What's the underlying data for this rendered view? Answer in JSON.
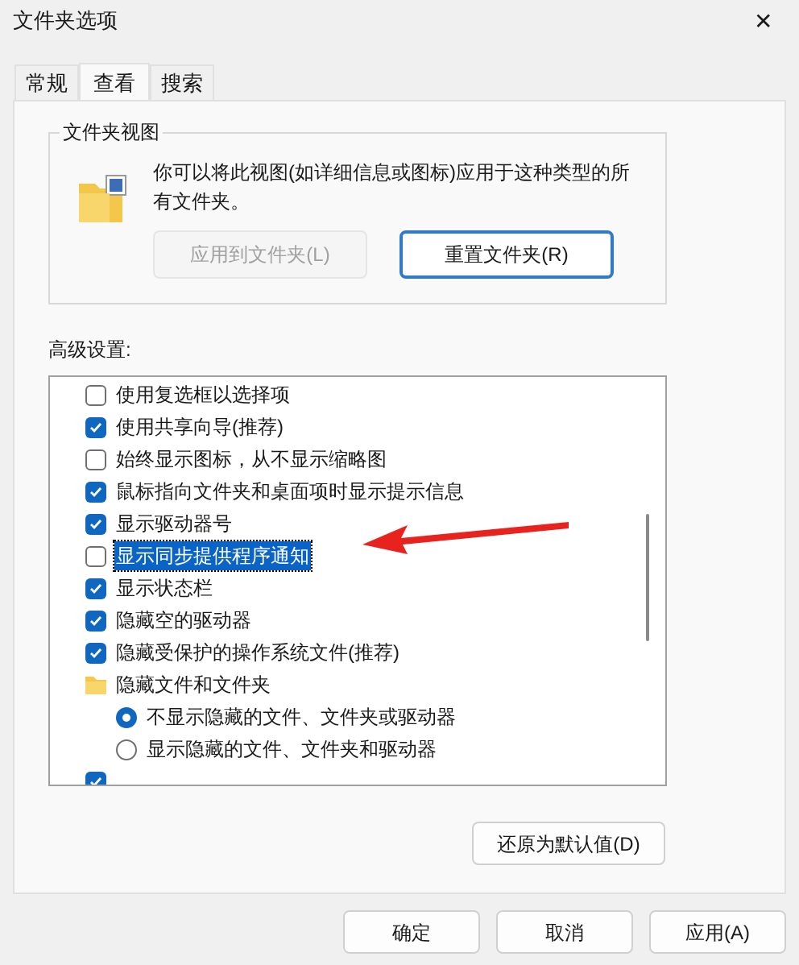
{
  "window": {
    "title": "文件夹选项",
    "close": "✕"
  },
  "tabs": [
    {
      "label": "常规",
      "selected": false
    },
    {
      "label": "查看",
      "selected": true
    },
    {
      "label": "搜索",
      "selected": false
    }
  ],
  "folder_views": {
    "title": "文件夹视图",
    "description": "你可以将此视图(如详细信息或图标)应用于这种类型的所有文件夹。",
    "buttons": [
      {
        "label": "应用到文件夹(L)",
        "disabled": true
      },
      {
        "label": "重置文件夹(R)",
        "disabled": false
      }
    ]
  },
  "advanced": {
    "label": "高级设置:",
    "items": [
      {
        "kind": "checkbox",
        "label": "使用复选框以选择项",
        "checked": false,
        "selected": false
      },
      {
        "kind": "checkbox",
        "label": "使用共享向导(推荐)",
        "checked": true,
        "selected": false
      },
      {
        "kind": "checkbox",
        "label": "始终显示图标，从不显示缩略图",
        "checked": false,
        "selected": false
      },
      {
        "kind": "checkbox",
        "label": "鼠标指向文件夹和桌面项时显示提示信息",
        "checked": true,
        "selected": false
      },
      {
        "kind": "checkbox",
        "label": "显示驱动器号",
        "checked": true,
        "selected": false
      },
      {
        "kind": "checkbox",
        "label": "显示同步提供程序通知",
        "checked": false,
        "selected": true
      },
      {
        "kind": "checkbox",
        "label": "显示状态栏",
        "checked": true,
        "selected": false
      },
      {
        "kind": "checkbox",
        "label": "隐藏空的驱动器",
        "checked": true,
        "selected": false
      },
      {
        "kind": "checkbox",
        "label": "隐藏受保护的操作系统文件(推荐)",
        "checked": true,
        "selected": false
      },
      {
        "kind": "folder",
        "label": "隐藏文件和文件夹",
        "selected": false,
        "children": [
          {
            "kind": "radio",
            "label": "不显示隐藏的文件、文件夹或驱动器",
            "checked": true,
            "selected": false
          },
          {
            "kind": "radio",
            "label": "显示隐藏的文件、文件夹和驱动器",
            "checked": false,
            "selected": false
          }
        ]
      },
      {
        "kind": "checkbox",
        "checked": true,
        "selected": false
      }
    ]
  },
  "restore_button": "还原为默认值(D)",
  "buttons": [
    "确定",
    "取消",
    "应用(A)"
  ]
}
